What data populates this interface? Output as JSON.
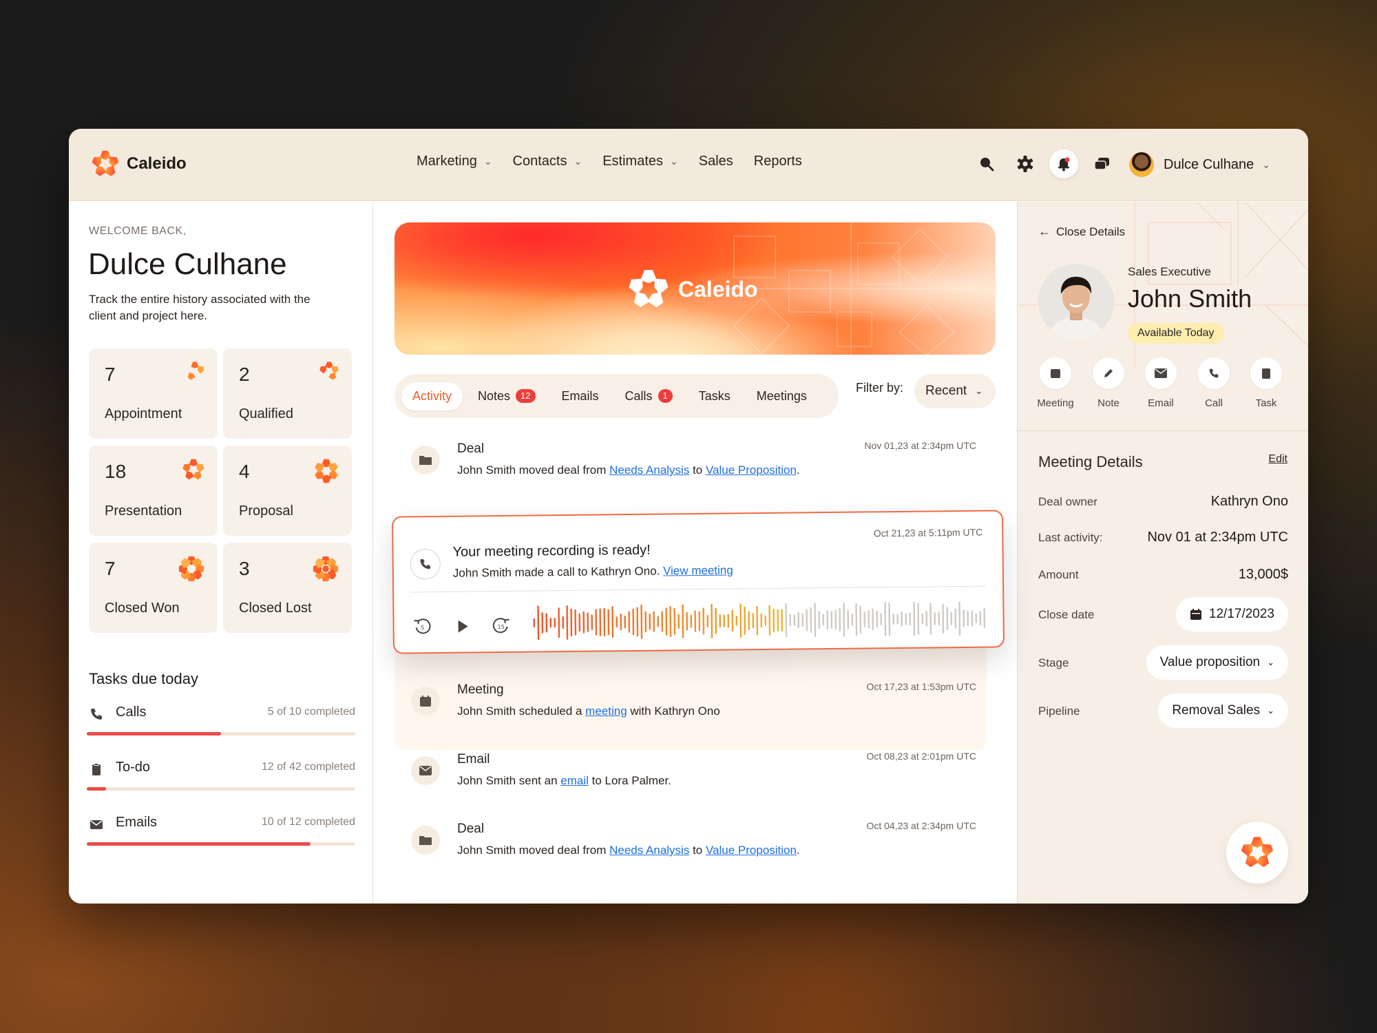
{
  "app": {
    "brand": "Caleido"
  },
  "nav": {
    "items": [
      {
        "label": "Marketing",
        "dropdown": true
      },
      {
        "label": "Contacts",
        "dropdown": true
      },
      {
        "label": "Estimates",
        "dropdown": true
      },
      {
        "label": "Sales",
        "dropdown": false
      },
      {
        "label": "Reports",
        "dropdown": false
      }
    ]
  },
  "topbar": {
    "icons": [
      "search-icon",
      "gear-icon",
      "bell-icon",
      "chat-icon"
    ],
    "user": "Dulce Culhane"
  },
  "left": {
    "welcome": "WELCOME BACK,",
    "name": "Dulce Culhane",
    "description": "Track the entire history associated with the client and project here.",
    "stats": [
      {
        "value": "7",
        "label": "Appointment"
      },
      {
        "value": "2",
        "label": "Qualified"
      },
      {
        "value": "18",
        "label": "Presentation"
      },
      {
        "value": "4",
        "label": "Proposal"
      },
      {
        "value": "7",
        "label": "Closed Won"
      },
      {
        "value": "3",
        "label": "Closed Lost"
      }
    ],
    "tasks_title": "Tasks due today",
    "tasks": [
      {
        "name": "Calls",
        "status": "5 of 10 completed",
        "progress": 0.5,
        "icon": "phone-icon"
      },
      {
        "name": "To-do",
        "status": "12 of 42 completed",
        "progress": 0.0714,
        "icon": "clipboard-icon"
      },
      {
        "name": "Emails",
        "status": "10 of 12 completed",
        "progress": 0.8333,
        "icon": "mail-icon"
      }
    ]
  },
  "center": {
    "banner_brand": "Caleido",
    "tabs": [
      {
        "label": "Activity",
        "badge": ""
      },
      {
        "label": "Notes",
        "badge": "12"
      },
      {
        "label": "Emails",
        "badge": ""
      },
      {
        "label": "Calls",
        "badge": "1"
      },
      {
        "label": "Tasks",
        "badge": ""
      },
      {
        "label": "Meetings",
        "badge": ""
      }
    ],
    "filter_label": "Filter by:",
    "filter_value": "Recent",
    "activities": {
      "deal1": {
        "title": "Deal",
        "pre": "John Smith moved deal from ",
        "link1": "Needs Analysis",
        "mid": " to ",
        "link2": "Value Proposition",
        "post": ".",
        "time": "Nov 01,23 at 2:34pm UTC"
      },
      "recording": {
        "title": "Your meeting recording is ready!",
        "pre": "John Smith made a call to Kathryn Ono. ",
        "link": "View meeting",
        "time": "Oct 21,23 at 5:11pm UTC",
        "played_fraction": 0.55
      },
      "meeting": {
        "title": "Meeting",
        "pre": "John Smith scheduled a ",
        "link": "meeting",
        "post": " with Kathryn Ono",
        "time": "Oct 17,23 at 1:53pm UTC"
      },
      "email": {
        "title": "Email",
        "pre": "John Smith sent an ",
        "link": "email",
        "post": " to Lora Palmer.",
        "time": "Oct 08,23 at 2:01pm UTC"
      },
      "deal2": {
        "title": "Deal",
        "pre": "John Smith moved deal from ",
        "link1": "Needs Analysis",
        "mid": " to ",
        "link2": "Value Proposition",
        "post": ".",
        "time": "Oct 04,23 at 2:34pm UTC"
      }
    }
  },
  "right": {
    "close_label": "Close Details",
    "role": "Sales Executive",
    "name": "John Smith",
    "availability": "Available Today",
    "actions": [
      "Meeting",
      "Note",
      "Email",
      "Call",
      "Task"
    ],
    "details_title": "Meeting Details",
    "edit_label": "Edit",
    "deal_owner_label": "Deal owner",
    "deal_owner": "Kathryn Ono",
    "last_activity_label": "Last activity:",
    "last_activity": "Nov 01 at 2:34pm UTC",
    "amount_label": "Amount",
    "amount": "13,000$",
    "close_date_label": "Close date",
    "close_date": "12/17/2023",
    "stage_label": "Stage",
    "stage": "Value proposition",
    "pipeline_label": "Pipeline",
    "pipeline": "Removal Sales"
  },
  "colors": {
    "accent": "#f05b2a",
    "progress": "#ec4a4a",
    "link": "#1f6fe0",
    "panel": "#f7eee6"
  }
}
